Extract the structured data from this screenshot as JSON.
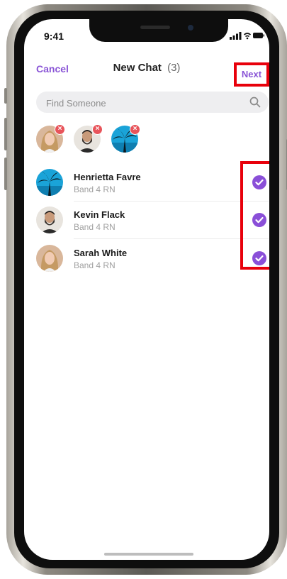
{
  "status_bar": {
    "time": "9:41"
  },
  "nav": {
    "cancel_label": "Cancel",
    "title": "New Chat",
    "count": "(3)",
    "next_label": "Next"
  },
  "search": {
    "placeholder": "Find Someone"
  },
  "selected_chips": [
    {
      "name": "Sarah White",
      "avatar": "woman-portrait"
    },
    {
      "name": "Kevin Flack",
      "avatar": "bearded-man-portrait"
    },
    {
      "name": "Henrietta Favre",
      "avatar": "palm-tree-blue"
    }
  ],
  "contacts": [
    {
      "name": "Henrietta Favre",
      "role": "Band 4 RN",
      "checked": true
    },
    {
      "name": "Kevin Flack",
      "role": "Band 4 RN",
      "checked": true
    },
    {
      "name": "Sarah White",
      "role": "Band 4 RN",
      "checked": true
    }
  ],
  "colors": {
    "accent": "#8a4fd8",
    "highlight": "#e8000b",
    "remove": "#e8545a"
  }
}
